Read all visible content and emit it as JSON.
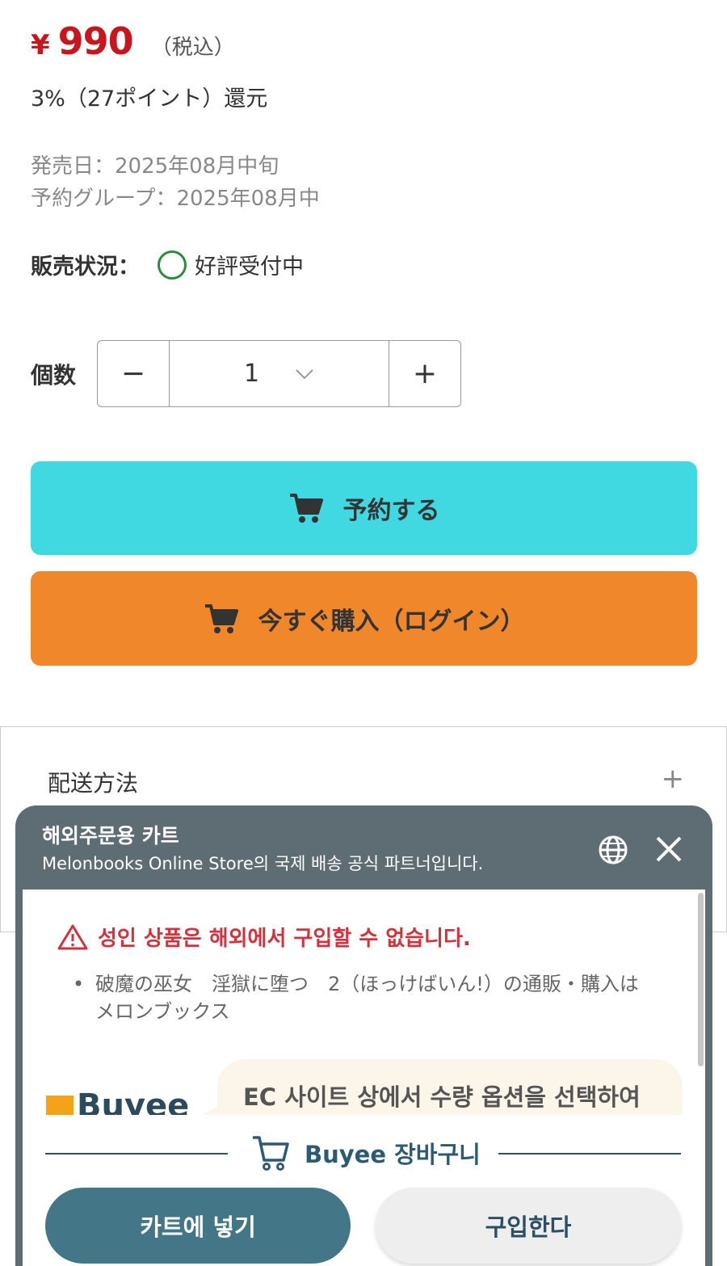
{
  "product": {
    "currency_symbol": "¥",
    "price": "990",
    "tax_note": "（税込）",
    "points": "3%（27ポイント）還元",
    "release_date": "発売日：2025年08月中旬",
    "reserve_group": "予約グループ：2025年08月中",
    "status_label": "販売状況：",
    "status_value": "好評受付中"
  },
  "quantity": {
    "label": "個数",
    "minus": "−",
    "value": "1",
    "plus": "+"
  },
  "actions": {
    "reserve_label": "予約する",
    "buy_now_label": "今すぐ購入（ログイン）"
  },
  "delivery": {
    "title": "配送方法",
    "expand": "+"
  },
  "buyee_panel": {
    "title": "해외주문용 카트",
    "subtitle": "Melonbooks Online Store의 국제 배송 공식 파트너입니다.",
    "warning": "성인 상품은 해외에서 구입할 수 없습니다.",
    "item_text": "破魔の巫女　淫獄に堕つ　2（ほっけばいん!）の通販・購入はメロンブックス",
    "logo_text": "Buyee",
    "bubble_text": "EC 사이트 상에서 수량 옵션을 선택하여",
    "cart_title": "Buyee 장바구니",
    "add_to_cart": "카트에 넣기",
    "buy": "구입한다"
  },
  "colors": {
    "price_red": "#c8161d",
    "reserve_cyan": "#41d9e1",
    "buy_orange": "#f0872a",
    "status_green": "#2e8b3e",
    "panel_header": "#5e6c74",
    "warning_red": "#d6303c",
    "buyee_teal": "#437788"
  }
}
